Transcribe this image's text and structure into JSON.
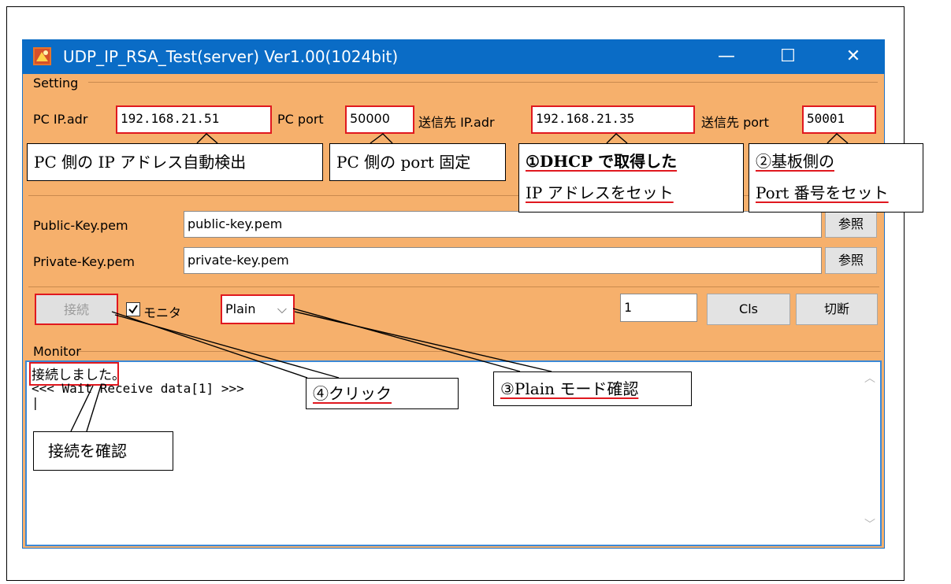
{
  "window": {
    "title": "UDP_IP_RSA_Test(server) Ver1.00(1024bit)",
    "minimize": "—",
    "maximize": "☐",
    "close": "✕"
  },
  "setting": {
    "group_label": "Setting",
    "pc_ip_label": "PC IP.adr",
    "pc_ip_value": "192.168.21.51",
    "pc_port_label": "PC port",
    "pc_port_value": "50000",
    "dest_ip_label": "送信先 IP.adr",
    "dest_ip_value": "192.168.21.35",
    "dest_port_label": "送信先 port",
    "dest_port_value": "50001"
  },
  "keys": {
    "public_label": "Public-Key.pem",
    "public_value": "public-key.pem",
    "private_label": "Private-Key.pem",
    "private_value": "private-key.pem",
    "browse_label": "参照"
  },
  "controls": {
    "connect_label": "接続",
    "monitor_label": "モニタ",
    "mode_value": "Plain",
    "count_value": "1",
    "cls_label": "Cls",
    "disconnect_label": "切断"
  },
  "monitor": {
    "group_label": "Monitor",
    "lines": [
      "接続しました。",
      "<<< Wait Receive data[1] >>>",
      "|"
    ]
  },
  "callouts": {
    "pc_ip": "PC 側の IP アドレス自動検出",
    "pc_port": "PC 側の port 固定",
    "dhcp_line1": "①DHCP で取得した",
    "dhcp_line2": "IP アドレスをセット",
    "board_line1": "②基板側の",
    "board_line2": "Port 番号をセット",
    "plain": "③Plain モード確認",
    "click": "④クリック",
    "confirm": "接続を確認"
  }
}
